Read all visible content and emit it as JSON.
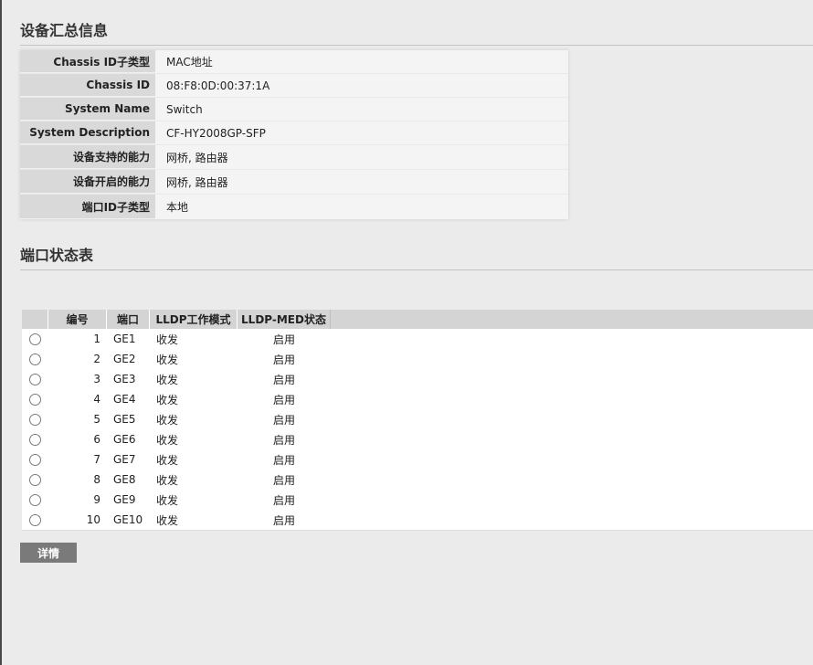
{
  "summary": {
    "title": "设备汇总信息",
    "rows": [
      {
        "label": "Chassis ID子类型",
        "value": "MAC地址"
      },
      {
        "label": "Chassis ID",
        "value": "08:F8:0D:00:37:1A"
      },
      {
        "label": "System Name",
        "value": "Switch"
      },
      {
        "label": "System Description",
        "value": "CF-HY2008GP-SFP"
      },
      {
        "label": "设备支持的能力",
        "value": "网桥, 路由器"
      },
      {
        "label": "设备开启的能力",
        "value": "网桥, 路由器"
      },
      {
        "label": "端口ID子类型",
        "value": "本地"
      }
    ]
  },
  "ports": {
    "title": "端口状态表",
    "headers": {
      "num": "编号",
      "port": "端口",
      "mode": "LLDP工作模式",
      "med": "LLDP-MED状态"
    },
    "rows": [
      {
        "num": "1",
        "port": "GE1",
        "mode": "收发",
        "med": "启用"
      },
      {
        "num": "2",
        "port": "GE2",
        "mode": "收发",
        "med": "启用"
      },
      {
        "num": "3",
        "port": "GE3",
        "mode": "收发",
        "med": "启用"
      },
      {
        "num": "4",
        "port": "GE4",
        "mode": "收发",
        "med": "启用"
      },
      {
        "num": "5",
        "port": "GE5",
        "mode": "收发",
        "med": "启用"
      },
      {
        "num": "6",
        "port": "GE6",
        "mode": "收发",
        "med": "启用"
      },
      {
        "num": "7",
        "port": "GE7",
        "mode": "收发",
        "med": "启用"
      },
      {
        "num": "8",
        "port": "GE8",
        "mode": "收发",
        "med": "启用"
      },
      {
        "num": "9",
        "port": "GE9",
        "mode": "收发",
        "med": "启用"
      },
      {
        "num": "10",
        "port": "GE10",
        "mode": "收发",
        "med": "启用"
      }
    ]
  },
  "actions": {
    "detail_label": "详情"
  },
  "colors": {
    "page_bg": "#ebebeb",
    "label_bg": "#d9d9d9",
    "table_header_bg": "#d4d4d4",
    "button_bg": "#7a7a7a"
  }
}
